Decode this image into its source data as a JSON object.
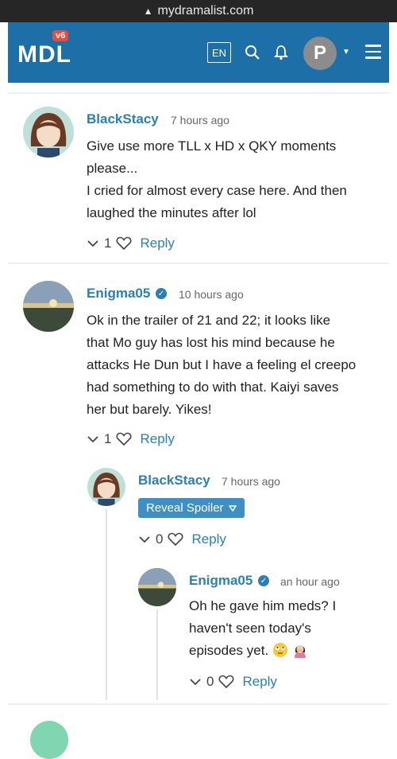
{
  "browser": {
    "url": "mydramalist.com"
  },
  "navbar": {
    "logo": "MDL",
    "version_badge": "v6",
    "lang": "EN",
    "user_initial": "P"
  },
  "comments": [
    {
      "username": "BlackStacy",
      "time": "7 hours ago",
      "lines": [
        "Give use more TLL x HD x QKY moments",
        "please...",
        "I cried for almost every case here. And then",
        "laughed the minutes after lol"
      ],
      "likes": "1",
      "reply_label": "Reply"
    },
    {
      "username": "Enigma05",
      "time": "10 hours ago",
      "lines": [
        "Ok in the trailer of 21 and 22; it looks like",
        "that Mo guy has lost his mind because he",
        "attacks He Dun but I have a feeling el creepo",
        "had something to do with that. Kaiyi saves",
        "her but barely. Yikes!"
      ],
      "likes": "1",
      "reply_label": "Reply"
    },
    {
      "username": "BlackStacy",
      "time": "7 hours ago",
      "spoiler_label": "Reveal Spoiler",
      "likes": "0",
      "reply_label": "Reply"
    },
    {
      "username": "Enigma05",
      "time": "an hour ago",
      "lines": [
        "Oh he gave him meds? I",
        "haven't seen today's",
        "episodes yet."
      ],
      "likes": "0",
      "reply_label": "Reply"
    }
  ]
}
